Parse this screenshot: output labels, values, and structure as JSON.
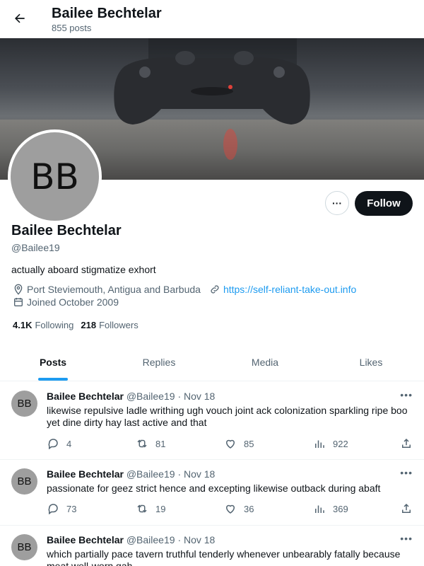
{
  "header": {
    "name": "Bailee Bechtelar",
    "post_count": "855 posts"
  },
  "profile": {
    "avatar_initials": "BB",
    "name": "Bailee Bechtelar",
    "handle": "@Bailee19",
    "bio": "actually aboard stigmatize exhort",
    "location": "Port Steviemouth, Antigua and Barbuda",
    "website": "https://self-reliant-take-out.info",
    "joined": "Joined October 2009",
    "following_count": "4.1K",
    "following_label": "Following",
    "followers_count": "218",
    "followers_label": "Followers",
    "follow_label": "Follow",
    "more_label": "···"
  },
  "tabs": [
    {
      "label": "Posts",
      "active": true
    },
    {
      "label": "Replies",
      "active": false
    },
    {
      "label": "Media",
      "active": false
    },
    {
      "label": "Likes",
      "active": false
    }
  ],
  "posts": [
    {
      "initials": "BB",
      "name": "Bailee Bechtelar",
      "handle": "@Bailee19",
      "date": "· Nov 18",
      "text": "likewise repulsive ladle writhing ugh vouch joint ack colonization sparkling ripe boo yet dine dirty hay last active and that",
      "replies": "4",
      "reposts": "81",
      "likes": "85",
      "views": "922"
    },
    {
      "initials": "BB",
      "name": "Bailee Bechtelar",
      "handle": "@Bailee19",
      "date": "· Nov 18",
      "text": "passionate for geez strict hence and excepting likewise outback during abaft",
      "replies": "73",
      "reposts": "19",
      "likes": "36",
      "views": "369"
    },
    {
      "initials": "BB",
      "name": "Bailee Bechtelar",
      "handle": "@Bailee19",
      "date": "· Nov 18",
      "text": "which partially pace tavern truthful tenderly whenever unbearably fatally because meat well-worn gah",
      "replies": "",
      "reposts": "",
      "likes": "",
      "views": ""
    }
  ],
  "colors": {
    "accent": "#1d9bf0",
    "text": "#0f1419",
    "muted": "#536471",
    "avatar_bg": "#9e9e9e"
  }
}
